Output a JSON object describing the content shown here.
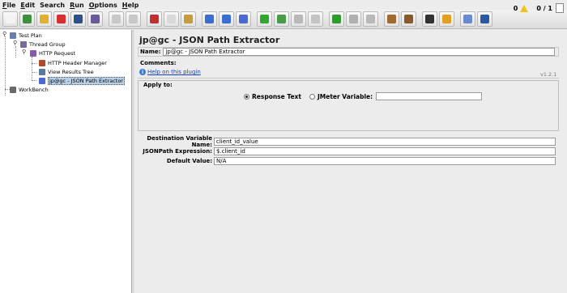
{
  "menu": [
    {
      "key": "F",
      "rest": "ile"
    },
    {
      "key": "E",
      "rest": "dit"
    },
    {
      "key": "",
      "rest": "Search"
    },
    {
      "key": "R",
      "rest": "un"
    },
    {
      "key": "O",
      "rest": "ptions"
    },
    {
      "key": "H",
      "rest": "elp"
    }
  ],
  "toolbar": {
    "buttons": [
      {
        "name": "new-icon",
        "color": "#f4f4f4"
      },
      {
        "name": "templates-icon",
        "color": "#3f8f3f"
      },
      {
        "name": "open-icon",
        "color": "#e0b030"
      },
      {
        "name": "close-icon",
        "color": "#d83030"
      },
      {
        "name": "save-icon",
        "color": "#2d4f8a"
      },
      {
        "name": "save-as-icon",
        "color": "#6a5a9a"
      },
      {
        "name": "sep"
      },
      {
        "name": "undo-icon",
        "color": "#c8c8c8"
      },
      {
        "name": "redo-icon",
        "color": "#c8c8c8"
      },
      {
        "name": "sep"
      },
      {
        "name": "cut-icon",
        "color": "#c03030"
      },
      {
        "name": "copy-icon",
        "color": "#d9d9d9"
      },
      {
        "name": "paste-icon",
        "color": "#c79a3a"
      },
      {
        "name": "sep"
      },
      {
        "name": "expand-icon",
        "color": "#3a6fd0"
      },
      {
        "name": "collapse-icon",
        "color": "#3a6fd0"
      },
      {
        "name": "toggle-icon",
        "color": "#4a6ad0"
      },
      {
        "name": "sep"
      },
      {
        "name": "start-icon",
        "color": "#2fa82f"
      },
      {
        "name": "start-no-timers-icon",
        "color": "#4a9a4a"
      },
      {
        "name": "stop-icon",
        "color": "#b8b8b8"
      },
      {
        "name": "shutdown-icon",
        "color": "#c4c4c4"
      },
      {
        "name": "sep"
      },
      {
        "name": "remote-start-icon",
        "color": "#2f9a2f"
      },
      {
        "name": "remote-stop-icon",
        "color": "#b0b0b0"
      },
      {
        "name": "remote-shutdown-icon",
        "color": "#b8b8b8"
      },
      {
        "name": "sep"
      },
      {
        "name": "clear-icon",
        "color": "#a06a30"
      },
      {
        "name": "clear-all-icon",
        "color": "#8a5a2a"
      },
      {
        "name": "sep"
      },
      {
        "name": "search-icon",
        "color": "#333333"
      },
      {
        "name": "reset-search-icon",
        "color": "#e0a020"
      },
      {
        "name": "sep"
      },
      {
        "name": "function-helper-icon",
        "color": "#6a8ad0"
      },
      {
        "name": "help-icon",
        "color": "#2a5aa0"
      }
    ],
    "warning_count": "0",
    "threads": "0 / 1"
  },
  "tree": {
    "items": [
      {
        "label": "Test Plan",
        "icon": "test-plan-icon",
        "color": "#6a7fa8"
      },
      {
        "label": "Thread Group",
        "icon": "thread-group-icon",
        "color": "#7a6a9a"
      },
      {
        "label": "HTTP Request",
        "icon": "sampler-icon",
        "color": "#8a5ab0"
      },
      {
        "label": "HTTP Header Manager",
        "icon": "header-manager-icon",
        "color": "#b04a2a"
      },
      {
        "label": "View Results Tree",
        "icon": "listener-icon",
        "color": "#5a7a9a"
      },
      {
        "label": "jp@gc - JSON Path Extractor",
        "icon": "extractor-icon",
        "color": "#4a6ad0"
      },
      {
        "label": "WorkBench",
        "icon": "workbench-icon",
        "color": "#6a6a6a"
      }
    ]
  },
  "panel": {
    "title": "jp@gc - JSON Path Extractor",
    "name_label": "Name:",
    "name_value": "jp@gc - JSON Path Extractor",
    "comments_label": "Comments:",
    "help_link": "Help on this plugin",
    "version": "v1.2.1",
    "apply_to": {
      "legend": "Apply to:",
      "response_text": "Response Text",
      "jmeter_variable": "JMeter Variable:",
      "jmeter_variable_value": ""
    },
    "fields": [
      {
        "label": "Destination Variable Name:",
        "value": "client_id_value"
      },
      {
        "label": "JSONPath Expression:",
        "value": "$.client_id"
      },
      {
        "label": "Default Value:",
        "value": "N/A"
      }
    ]
  }
}
